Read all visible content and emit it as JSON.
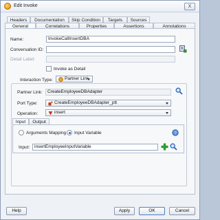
{
  "window": {
    "title": "Edit Invoke",
    "close_label": "X"
  },
  "tabs_top": [
    "Headers",
    "Documentation",
    "Skip Condition",
    "Targets",
    "Sources"
  ],
  "tabs_bottom": [
    "General",
    "Correlations",
    "Properties",
    "Assertions",
    "Annotations"
  ],
  "general": {
    "name_label": "Name:",
    "name_value": "InvokeCallInsertDBA",
    "conversation_label": "Conversation ID:",
    "conversation_value": "",
    "detail_label": "Detail Label:",
    "detail_value": "",
    "invoke_as_detail_label": "Invoke as Detail",
    "interaction_label": "Interaction Type:",
    "interaction_value": "Partner Link",
    "partner_link_label": "Partner Link:",
    "partner_link_value": "CreateEmployeeDBAdapter",
    "port_type_label": "Port Type:",
    "port_type_value": "CreateEmployeeDBAdapter_ptt",
    "operation_label": "Operation:",
    "operation_value": "insert",
    "inner_tabs": [
      "Input",
      "Output"
    ],
    "arguments_mapping_label": "Arguments Mapping",
    "input_variable_label": "Input Variable",
    "input_label": "Input:",
    "input_value": "insertEmployeeInputVariable"
  },
  "footer": {
    "help": "Help",
    "apply": "Apply",
    "ok": "OK",
    "cancel": "Cancel"
  },
  "colors": {
    "accent": "#2b5fb3",
    "add_green": "#2e9b2e",
    "search_blue": "#2f64b9"
  }
}
